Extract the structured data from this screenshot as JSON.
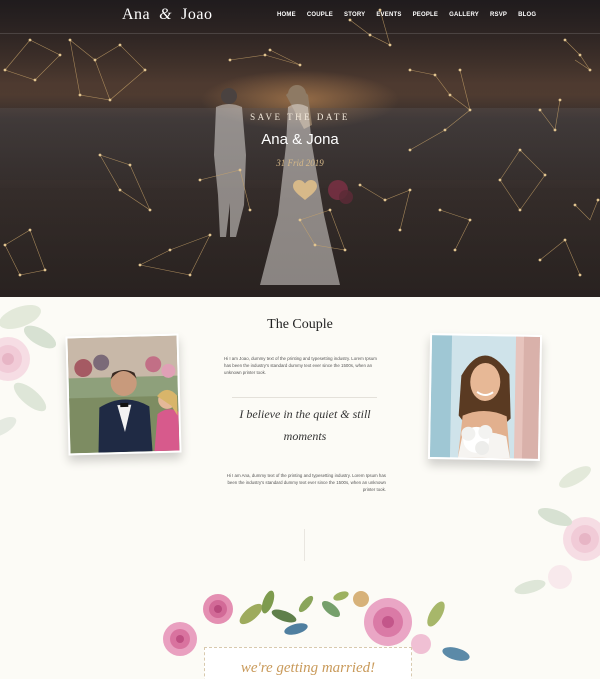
{
  "nav": {
    "logo_first": "Ana",
    "logo_amp": "&",
    "logo_second": "Joao",
    "items": [
      "HOME",
      "COUPLE",
      "STORY",
      "EVENTS",
      "PEOPLE",
      "GALLERY",
      "RSVP",
      "BLOG"
    ]
  },
  "hero": {
    "save_the_date": "SAVE THE DATE",
    "names": "Ana & Jona",
    "date": "31 Frid 2019"
  },
  "couple": {
    "title": "The Couple",
    "joao_bio": "Hi I am Joao, dummy text of the printing and typesetting industry. Lorem Ipsum has been the industry's standard dummy text ever since the 1500s, when an unknown printer took.",
    "quote": "I believe in the quiet & still moments",
    "ana_bio": "Hi I am Ana, dummy text of the printing and typesetting industry. Lorem Ipsum has been the industry's standard dummy text ever since the 1500s, when an unknown printer took."
  },
  "married": {
    "text": "we're getting married!"
  },
  "colors": {
    "gold": "#d7b989",
    "cream": "#fcfbf6",
    "pink": "#e48fb2"
  }
}
